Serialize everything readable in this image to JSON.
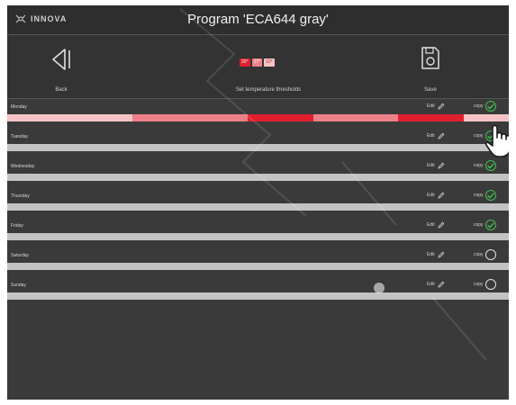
{
  "app": {
    "logo_text": "INNOVA",
    "title": "Program 'ECA644 gray'"
  },
  "toolbar": {
    "back_label": "Back",
    "thresholds_label": "Set temperature thresholds",
    "save_label": "Save",
    "thresholds": [
      {
        "value": "20°",
        "color": "#e02030"
      },
      {
        "value": "17°",
        "color": "#ee8088"
      },
      {
        "value": "10°",
        "color": "#f6c4c6"
      }
    ]
  },
  "day_labels": {
    "edit": "Edit",
    "copy": "copy"
  },
  "days": [
    {
      "name": "Monday",
      "copy_checked": true,
      "schedule": [
        {
          "span": 25,
          "color": "#f6c4c6"
        },
        {
          "span": 23,
          "color": "#ee8088"
        },
        {
          "span": 13,
          "color": "#e02030"
        },
        {
          "span": 17,
          "color": "#ee8088"
        },
        {
          "span": 13,
          "color": "#e02030"
        },
        {
          "span": 9,
          "color": "#f6c4c6"
        }
      ]
    },
    {
      "name": "Tuesday",
      "copy_checked": true,
      "schedule": []
    },
    {
      "name": "Wednesday",
      "copy_checked": true,
      "schedule": []
    },
    {
      "name": "Thursday",
      "copy_checked": true,
      "schedule": []
    },
    {
      "name": "Friday",
      "copy_checked": true,
      "schedule": []
    },
    {
      "name": "Saturday",
      "copy_checked": false,
      "schedule": []
    },
    {
      "name": "Sunday",
      "copy_checked": false,
      "schedule": []
    }
  ],
  "colors": {
    "background": "#3a3a3a",
    "check": "#3fbf4f",
    "empty_bar": "#c3c3c3"
  }
}
